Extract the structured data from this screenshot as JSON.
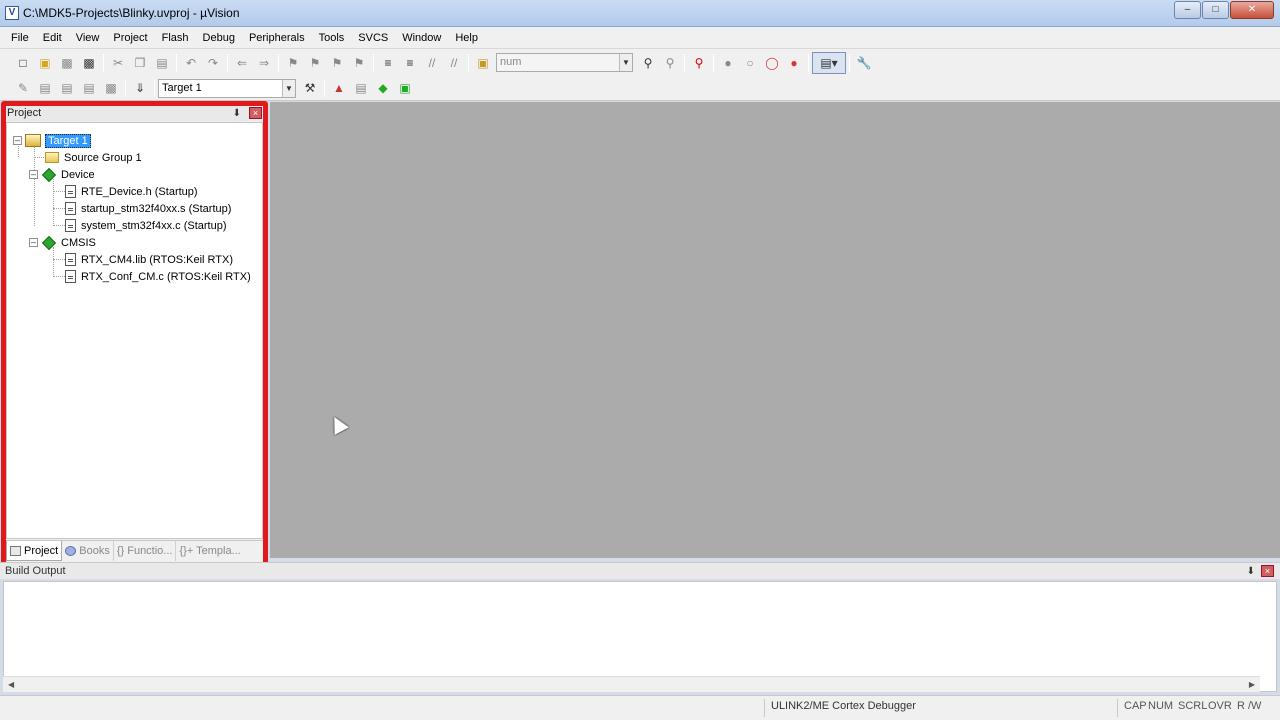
{
  "window": {
    "title": "C:\\MDK5-Projects\\Blinky.uvproj - µVision",
    "app_icon": "V",
    "minimize": "–",
    "maximize": "□",
    "close": "✕"
  },
  "menu": [
    "File",
    "Edit",
    "View",
    "Project",
    "Flash",
    "Debug",
    "Peripherals",
    "Tools",
    "SVCS",
    "Window",
    "Help"
  ],
  "toolbar": {
    "find_combo_value": "num",
    "target_combo_value": "Target 1"
  },
  "project_panel": {
    "title": "Project",
    "pin": "⬇",
    "close": "×",
    "tree": {
      "target": "Target 1",
      "group": "Source Group 1",
      "device": "Device",
      "device_files": [
        "RTE_Device.h (Startup)",
        "startup_stm32f40xx.s (Startup)",
        "system_stm32f4xx.c (Startup)"
      ],
      "cmsis": "CMSIS",
      "cmsis_files": [
        "RTX_CM4.lib (RTOS:Keil RTX)",
        "RTX_Conf_CM.c (RTOS:Keil RTX)"
      ]
    },
    "tabs": [
      "Project",
      "Books",
      "{} Functio...",
      "{}+ Templa..."
    ]
  },
  "build_output": {
    "title": "Build Output",
    "pin": "⬇",
    "close": "×"
  },
  "statusbar": {
    "debugger": "ULINK2/ME Cortex Debugger",
    "indicators": [
      "CAP",
      "NUM",
      "SCRL",
      "OVR",
      "R /W"
    ]
  },
  "colors": {
    "highlight_border": "#e01a1a",
    "workspace_bg": "#ababab",
    "selection": "#3399ff"
  }
}
